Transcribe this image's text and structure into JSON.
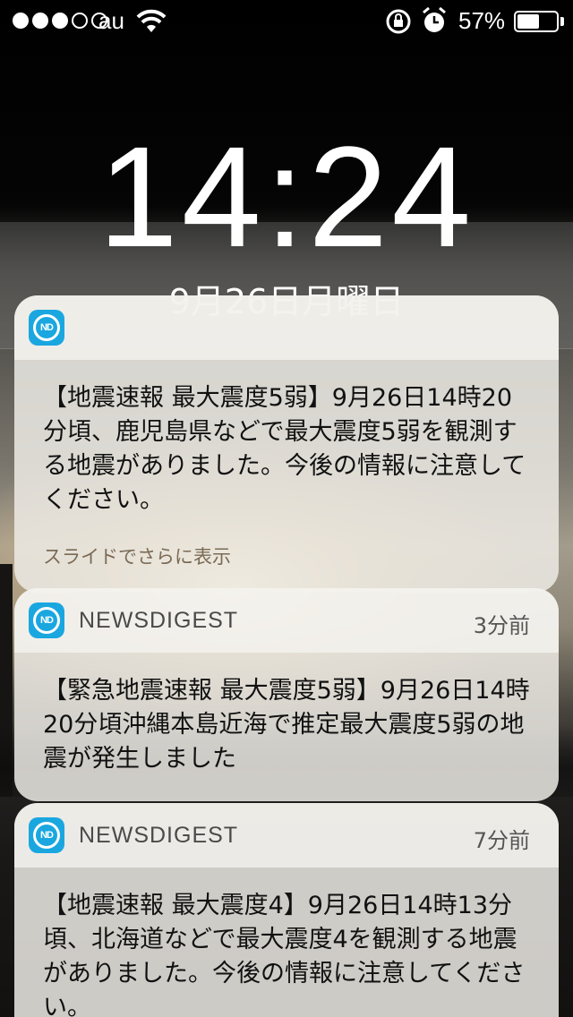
{
  "status_bar": {
    "signal_dots": [
      true,
      true,
      true,
      false,
      false
    ],
    "carrier": "au",
    "battery_percent": "57%",
    "battery_level": 0.57
  },
  "lock_screen": {
    "time": "14:24",
    "date": "9月26日月曜日"
  },
  "notifications": [
    {
      "app": "",
      "time_ago": "",
      "body": "【地震速報 最大震度5弱】9月26日14時20分頃、鹿児島県などで最大震度5弱を観測する地震がありました。今後の情報に注意してください。",
      "more": "スライドでさらに表示"
    },
    {
      "app": "NEWSDIGEST",
      "time_ago": "3分前",
      "body": "【緊急地震速報 最大震度5弱】9月26日14時20分頃沖縄本島近海で推定最大震度5弱の地震が発生しました"
    },
    {
      "app": "NEWSDIGEST",
      "time_ago": "7分前",
      "body": "【地震速報 最大震度4】9月26日14時13分頃、北海道などで最大震度4を観測する地震がありました。今後の情報に注意してください。"
    }
  ],
  "icons": {
    "app_icon": "newsdigest-icon",
    "app_icon_text": "ND"
  }
}
